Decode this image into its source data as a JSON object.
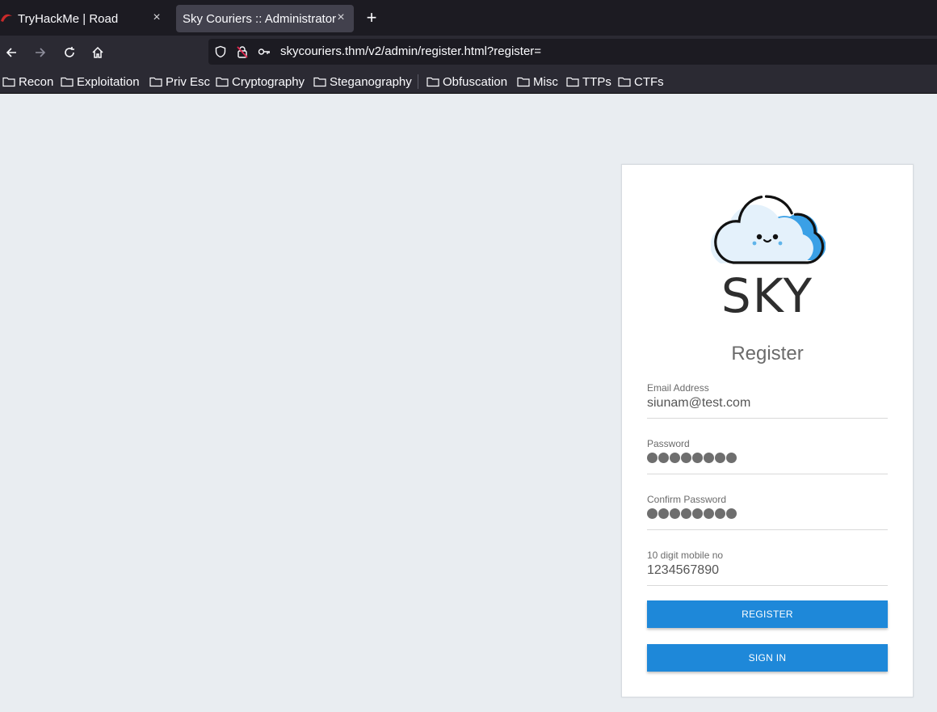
{
  "browser": {
    "tabs": [
      {
        "title": "TryHackMe | Road",
        "active": false
      },
      {
        "title": "Sky Couriers :: Administrator",
        "active": true
      }
    ],
    "tab_close_glyph": "×",
    "new_tab_glyph": "+",
    "url": "skycouriers.thm/v2/admin/register.html?register=",
    "bookmarks": [
      "Recon",
      "Exploitation",
      "Priv Esc",
      "Cryptography",
      "Steganography",
      "Obfuscation",
      "Misc",
      "TTPs",
      "CTFs"
    ]
  },
  "page": {
    "brand_text": "SKY",
    "form_title": "Register",
    "fields": [
      {
        "label": "Email Address",
        "value": "siunam@test.com",
        "masked": false
      },
      {
        "label": "Password",
        "value": "",
        "masked": true,
        "mask_count": 8
      },
      {
        "label": "Confirm Password",
        "value": "",
        "masked": true,
        "mask_count": 8
      },
      {
        "label": "10 digit mobile no",
        "value": "1234567890",
        "masked": false
      }
    ],
    "register_button": "REGISTER",
    "signin_button": "SIGN IN"
  },
  "colors": {
    "page_background": "#e9edf1",
    "button_blue": "#1e88d9",
    "cloud_blue": "#3aa0e6",
    "browser_dark": "#1c1b22"
  }
}
